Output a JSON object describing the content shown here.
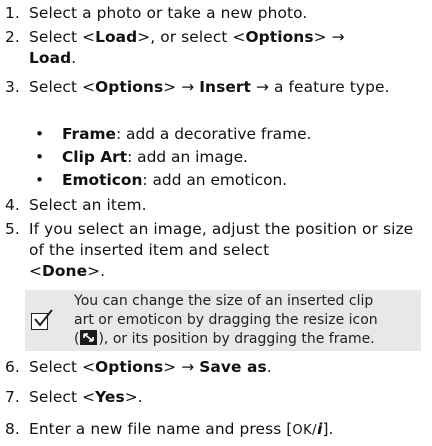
{
  "steps": [
    {
      "num": "1.",
      "text": "Select a photo or take a new photo."
    },
    {
      "num": "2.",
      "l1": "Select <",
      "b1": "Load",
      "l2": ">, or select <",
      "b2": "Options",
      "l3": "> →",
      "b3": "Load",
      "l4": "."
    },
    {
      "num": "3.",
      "l1": "Select <",
      "b1": "Options",
      "l2": "> → ",
      "b2": "Insert",
      "l3": " → a feature type."
    },
    {
      "num": "4.",
      "text": "Select an item."
    },
    {
      "num": "5.",
      "text": "If you select an image, adjust the position or size of the inserted item and select",
      "l1": "<",
      "b1": "Done",
      "l2": ">."
    },
    {
      "num": "6.",
      "l1": "Select <",
      "b1": "Options",
      "l2": "> → ",
      "b2": "Save as",
      "l3": "."
    },
    {
      "num": "7.",
      "l1": "Select <",
      "b1": "Yes",
      "l2": ">."
    },
    {
      "num": "8.",
      "text": "Enter a new file name and press [",
      "key": "OK/",
      "after": "]."
    }
  ],
  "bullets": [
    {
      "term": "Frame",
      "desc": ": add a decorative frame."
    },
    {
      "term": "Clip Art",
      "desc": ": add an image."
    },
    {
      "term": "Emoticon",
      "desc": ": add an emoticon."
    }
  ],
  "bullet_char": "•",
  "note": {
    "icon": "checkbox-check-icon",
    "line1": "You can change the size of an inserted clip",
    "line2": "art or emoticon by dragging the resize icon",
    "line3a": "(",
    "line3b": "), or its position by dragging the frame."
  }
}
